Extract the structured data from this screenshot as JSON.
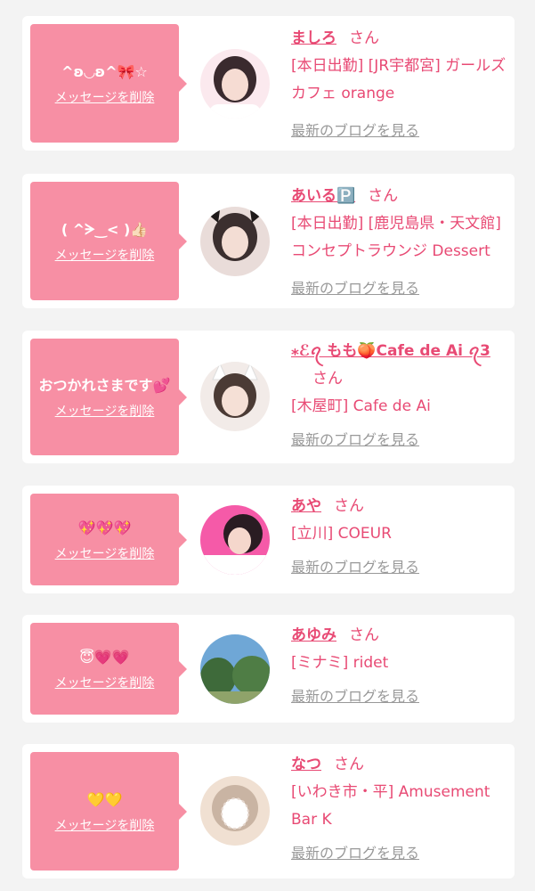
{
  "common": {
    "san": "さん",
    "delete_label": "メッセージを削除",
    "blog_label": "最新のブログを見る"
  },
  "items": [
    {
      "message": "^ʚ◡ʚ^🎀☆",
      "name": "ましろ",
      "shop": "[本日出勤] [JR宇都宮] ガールズカフェ orange",
      "avatar_colors": [
        "#fbe9ee",
        "#3a2a2e"
      ]
    },
    {
      "message": "( ^ᗒ‿< )👍🏻",
      "name": "あいる🅿️",
      "shop": "[本日出勤] [鹿児島県・天文館] コンセプトラウンジ Dessert",
      "avatar_colors": [
        "#e9dcd9",
        "#3b2f2f"
      ]
    },
    {
      "message": "おつかれさまです💕",
      "name": "⁎ℰꪖ もも🍑Cafe de Ai ꪖ3",
      "shop": "[木屋町] Cafe de Ai",
      "avatar_colors": [
        "#f2ebe8",
        "#4b3b35"
      ]
    },
    {
      "message": "💖💖💖",
      "name": "あや",
      "shop": "[立川] COEUR",
      "avatar_colors": [
        "#f55aa8",
        "#2a1c22"
      ]
    },
    {
      "message": "😇💗💗",
      "name": "あゆみ",
      "shop": "[ミナミ] ridet",
      "avatar_colors": [
        "#6fa7d6",
        "#3e6a3a"
      ]
    },
    {
      "message": "💛💛",
      "name": "なつ",
      "shop": "[いわき市・平] Amusement Bar K",
      "avatar_colors": [
        "#f0e0d2",
        "#c9b4a3"
      ]
    }
  ]
}
